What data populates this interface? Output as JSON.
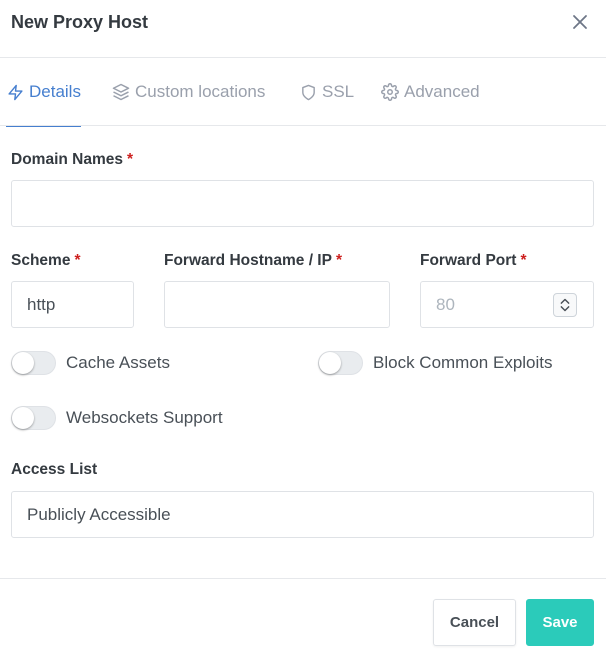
{
  "modal": {
    "title": "New Proxy Host",
    "close_icon": "close-icon"
  },
  "tabs": [
    {
      "label": "Details",
      "icon": "lightning-icon",
      "active": true
    },
    {
      "label": "Custom locations",
      "icon": "layers-icon",
      "active": false
    },
    {
      "label": "SSL",
      "icon": "shield-icon",
      "active": false
    },
    {
      "label": "Advanced",
      "icon": "gear-icon",
      "active": false
    }
  ],
  "form": {
    "domain_names": {
      "label": "Domain Names",
      "required_mark": "*",
      "value": ""
    },
    "scheme": {
      "label": "Scheme",
      "required_mark": "*",
      "value": "http"
    },
    "forward_host": {
      "label": "Forward Hostname / IP",
      "required_mark": "*",
      "value": ""
    },
    "forward_port": {
      "label": "Forward Port",
      "required_mark": "*",
      "placeholder": "80",
      "value": ""
    },
    "toggles": {
      "cache_assets": {
        "label": "Cache Assets",
        "on": false
      },
      "block_exploits": {
        "label": "Block Common Exploits",
        "on": false
      },
      "websockets": {
        "label": "Websockets Support",
        "on": false
      }
    },
    "access_list": {
      "label": "Access List",
      "value": "Publicly Accessible"
    }
  },
  "footer": {
    "cancel_label": "Cancel",
    "save_label": "Save"
  },
  "colors": {
    "accent": "#467fcf",
    "save_button": "#2bcbba",
    "required": "#cd201f"
  }
}
